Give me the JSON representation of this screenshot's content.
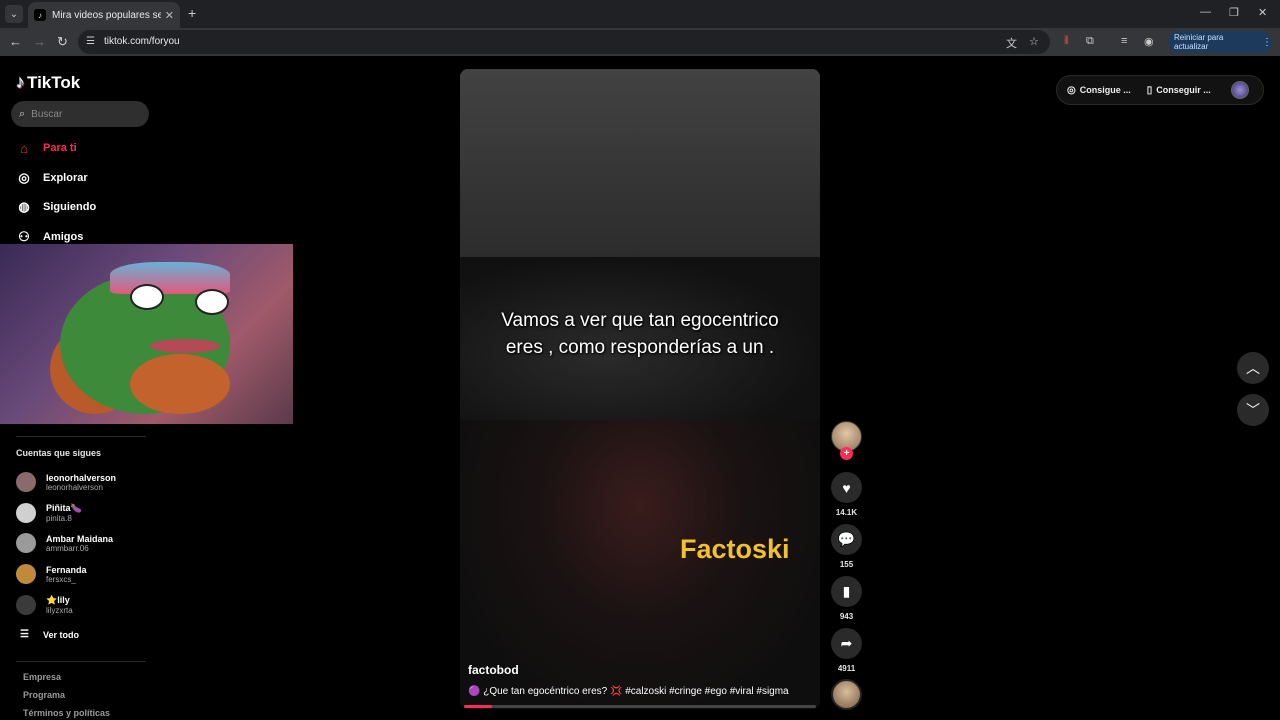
{
  "browser": {
    "tab_title": "Mira videos populares seleccionados",
    "tab_close": "✕",
    "new_tab": "+",
    "url": "tiktok.com/foryou",
    "restart_label": "Reiniciar para actualizar",
    "window_controls": [
      "—",
      "❐",
      "✕"
    ]
  },
  "sidebar": {
    "logo_text": "TikTok",
    "search_placeholder": "Buscar",
    "nav": [
      {
        "label": "Para ti",
        "icon": "home-icon",
        "active": true
      },
      {
        "label": "Explorar",
        "icon": "compass-icon",
        "active": false
      },
      {
        "label": "Siguiendo",
        "icon": "following-icon",
        "active": false
      },
      {
        "label": "Amigos",
        "icon": "friends-icon",
        "active": false
      }
    ],
    "following_title": "Cuentas que sigues",
    "accounts": [
      {
        "name": "leonorhalverson",
        "handle": "leonorhalverson",
        "color": "#8a6a6a"
      },
      {
        "name": "Piñita🍆",
        "handle": "pinita.8",
        "color": "#d0d0d0"
      },
      {
        "name": "Ambar Maidana",
        "handle": "ammbarr.06",
        "color": "#9a9a9a"
      },
      {
        "name": "Fernanda",
        "handle": "fersxcs_",
        "color": "#c08a3a"
      },
      {
        "name": "⭐lily",
        "handle": "lilyzxrta",
        "color": "#3a3a3a"
      }
    ],
    "see_all": "Ver todo",
    "footer": [
      "Empresa",
      "Programa",
      "Términos y políticas"
    ]
  },
  "video": {
    "overlay_text": "Vamos a ver que tan egocentrico eres , como responderías a un .",
    "watermark": "Factoski",
    "author": "factobod",
    "description": "🟣 ¿Que tan egocéntrico eres? 💢 #calzoski #cringe #ego #viral #sigma",
    "progress": 0.08
  },
  "actions": {
    "likes": "14.1K",
    "comments": "155",
    "saves": "943",
    "shares": "4911"
  },
  "top_right": {
    "coins_label": "Consigue ...",
    "app_label": "Conseguir ..."
  },
  "colors": {
    "accent": "#fe2c55",
    "watermark": "#f2c22e"
  }
}
